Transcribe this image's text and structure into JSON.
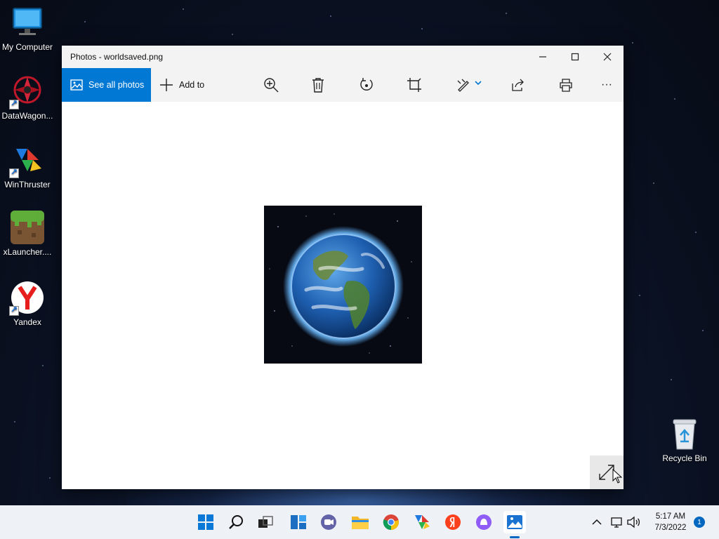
{
  "desktop": {
    "icons": [
      {
        "label": "My Computer",
        "icon": "monitor-icon"
      },
      {
        "label": "DataWagon...",
        "icon": "datawagon-icon"
      },
      {
        "label": "WinThruster",
        "icon": "winthruster-icon"
      },
      {
        "label": "xLauncher....",
        "icon": "minecraft-block-icon"
      },
      {
        "label": "Yandex",
        "icon": "yandex-browser-icon"
      }
    ],
    "recycle_bin": {
      "label": "Recycle Bin",
      "icon": "recycle-bin-icon"
    }
  },
  "window": {
    "title": "Photos - worldsaved.png",
    "controls": {
      "minimize": "—",
      "maximize": "☐",
      "close": "✕"
    },
    "toolbar": {
      "see_all_photos": "See all photos",
      "add_to": "Add to",
      "more": "···"
    },
    "image": {
      "filename": "worldsaved.png",
      "subject": "planet-earth"
    }
  },
  "taskbar": {
    "apps": [
      "windows-start-icon",
      "search-icon",
      "task-view-icon",
      "widgets-icon",
      "teams-chat-icon",
      "file-explorer-icon",
      "chrome-icon",
      "winthruster-icon",
      "yandex-icon",
      "alice-icon",
      "photos-icon"
    ],
    "clock": {
      "time": "5:17 AM",
      "date": "7/3/2022"
    },
    "notification_count": "1"
  },
  "colors": {
    "accent": "#0078d4",
    "taskbar": "#eef1f6"
  }
}
